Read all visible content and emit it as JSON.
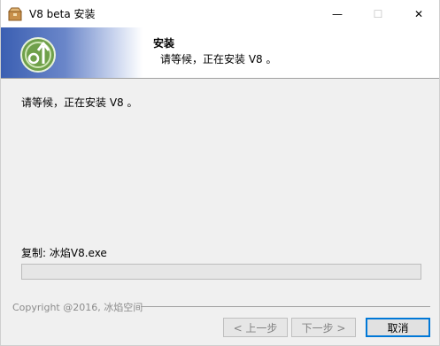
{
  "window": {
    "title": "V8 beta 安装",
    "minimize_glyph": "—",
    "maximize_glyph": "☐",
    "close_glyph": "✕",
    "app_icon": "installer-box-icon"
  },
  "header": {
    "title": "安装",
    "subtitle": "请等候，正在安装 V8 。",
    "logo_icon": "disc-install-icon",
    "gradient_color": "#3b5fb2"
  },
  "main": {
    "status": "请等候，正在安装 V8 。",
    "current_file": "复制: 冰焰V8.exe",
    "progress": 0
  },
  "footer": {
    "branding": "Copyright @2016, 冰焰空间",
    "back_label": "< 上一步",
    "next_label": "下一步 >",
    "cancel_label": "取消",
    "focus_color": "#0078d7"
  }
}
